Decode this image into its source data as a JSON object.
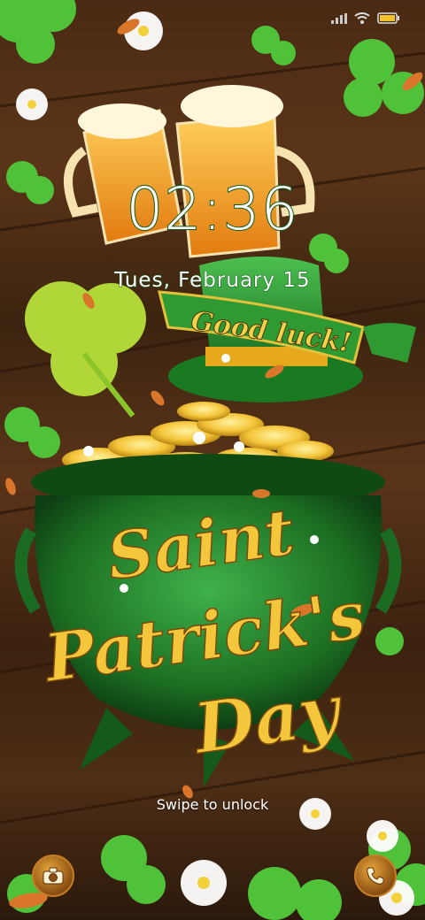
{
  "lock_screen": {
    "time": "02:36",
    "date": "Tues, February 15",
    "swipe_hint": "Swipe to unlock"
  },
  "wallpaper": {
    "banner_text": "Good luck!",
    "title_line1": "Saint",
    "title_line2": "Patrick's",
    "title_line3": "Day"
  },
  "shortcuts": {
    "left_icon": "camera-icon",
    "right_icon": "phone-icon"
  },
  "status_bar": {
    "icons": [
      "signal-icon",
      "wifi-icon",
      "battery-icon"
    ]
  },
  "colors": {
    "accent_green": "#1f8a2a",
    "gold": "#f4c63b",
    "wood": "#4a2a14"
  }
}
